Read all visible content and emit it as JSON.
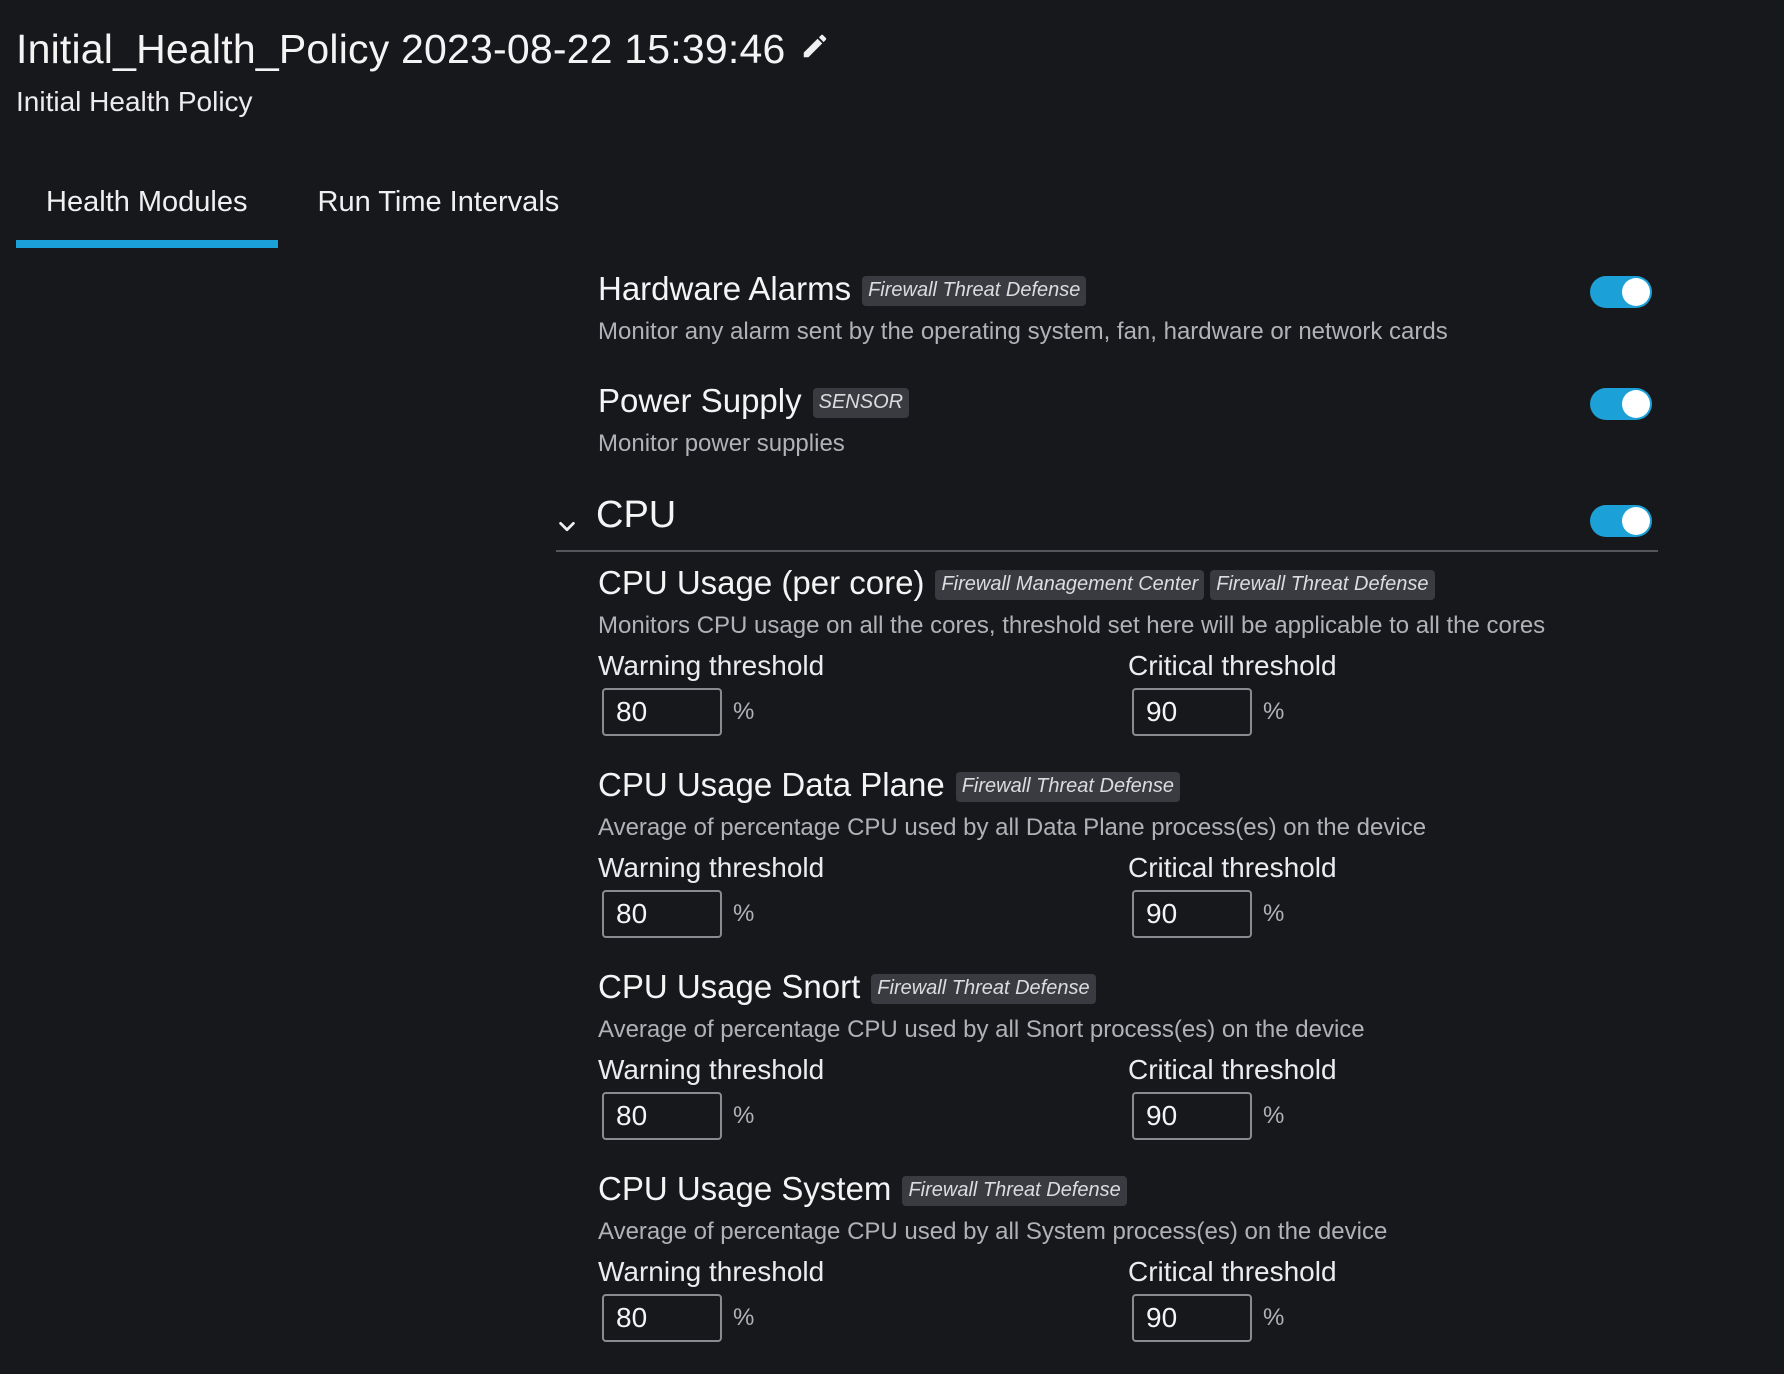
{
  "header": {
    "title": "Initial_Health_Policy 2023-08-22 15:39:46",
    "edit_icon": "pencil-icon",
    "subtitle": "Initial Health Policy"
  },
  "tabs": [
    {
      "label": "Health Modules",
      "active": true
    },
    {
      "label": "Run Time Intervals",
      "active": false
    }
  ],
  "colors": {
    "accent": "#1ba0d7",
    "background": "#17181c",
    "badge_bg": "#3a3b40"
  },
  "modules": {
    "hardware_alarms": {
      "name": "Hardware Alarms",
      "badges": [
        "Firewall Threat Defense"
      ],
      "description": "Monitor any alarm sent by the operating system, fan, hardware or network cards",
      "enabled": true
    },
    "power_supply": {
      "name": "Power Supply",
      "badges": [
        "SENSOR"
      ],
      "description": "Monitor power supplies",
      "enabled": true
    }
  },
  "cpu_section": {
    "title": "CPU",
    "expanded": true,
    "enabled": true,
    "collapse_icon": "chevron-down-icon",
    "items": [
      {
        "name": "CPU Usage (per core)",
        "badges": [
          "Firewall Management Center",
          "Firewall Threat Defense"
        ],
        "description": "Monitors CPU usage on all the cores, threshold set here will be applicable to all the cores",
        "warning_label": "Warning threshold",
        "warning_value": "80",
        "critical_label": "Critical threshold",
        "critical_value": "90",
        "unit": "%"
      },
      {
        "name": "CPU Usage Data Plane",
        "badges": [
          "Firewall Threat Defense"
        ],
        "description": "Average of percentage CPU used by all Data Plane process(es) on the device",
        "warning_label": "Warning threshold",
        "warning_value": "80",
        "critical_label": "Critical threshold",
        "critical_value": "90",
        "unit": "%"
      },
      {
        "name": "CPU Usage Snort",
        "badges": [
          "Firewall Threat Defense"
        ],
        "description": "Average of percentage CPU used by all Snort process(es) on the device",
        "warning_label": "Warning threshold",
        "warning_value": "80",
        "critical_label": "Critical threshold",
        "critical_value": "90",
        "unit": "%"
      },
      {
        "name": "CPU Usage System",
        "badges": [
          "Firewall Threat Defense"
        ],
        "description": "Average of percentage CPU used by all System process(es) on the device",
        "warning_label": "Warning threshold",
        "warning_value": "80",
        "critical_label": "Critical threshold",
        "critical_value": "90",
        "unit": "%"
      }
    ]
  }
}
